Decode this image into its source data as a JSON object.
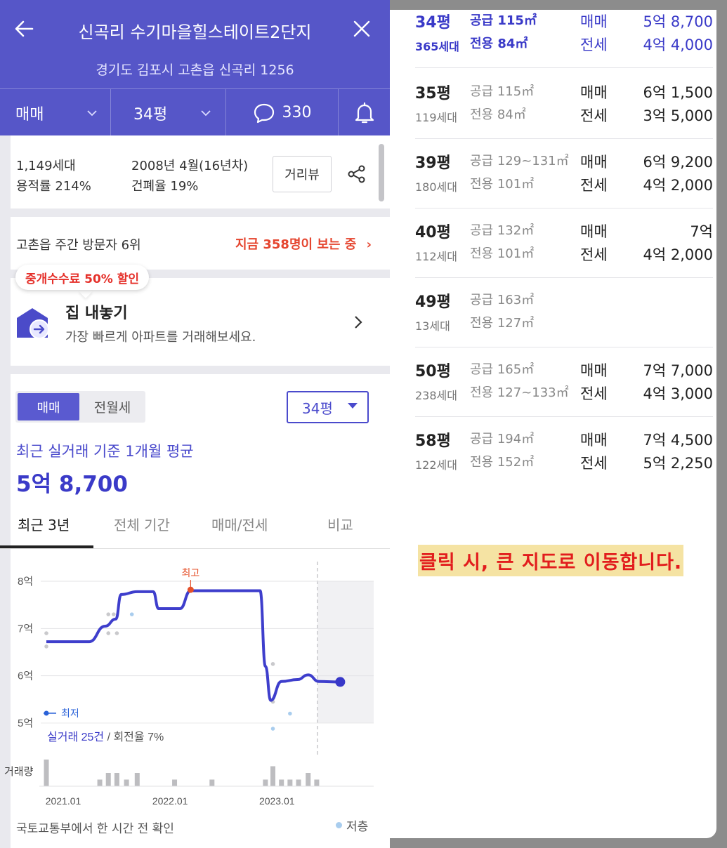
{
  "header": {
    "title": "신곡리 수기마을힐스테이트2단지",
    "address": "경기도 김포시 고촌읍 신곡리 1256",
    "trade_type": "매매",
    "size": "34평",
    "comment_count": "330"
  },
  "complex_info": {
    "households": "1,149세대",
    "floor_area_ratio": "용적률 214%",
    "built": "2008년 4월(16년차)",
    "building_coverage": "건폐율 19%",
    "street_view_label": "거리뷰"
  },
  "visitors": {
    "rank": "고촌읍 주간 방문자 6위",
    "now_viewing": "지금 358명이 보는 중",
    "chevron": "›"
  },
  "sell_card": {
    "promo": "중개수수료 50% 할인",
    "title": "집 내놓기",
    "subtitle": "가장 빠르게 아파트를 거래해보세요."
  },
  "deal": {
    "seg_sell": "매매",
    "seg_rent": "전월세",
    "size_select": "34평",
    "avg_label": "최근 실거래 기준 1개월 평균",
    "avg_price": "5억 8,700"
  },
  "tabs": [
    "최근 3년",
    "전체 기간",
    "매매/전세",
    "비교"
  ],
  "chart_data": {
    "type": "line",
    "y_unit": "억",
    "ylim": [
      5,
      8
    ],
    "yticks": [
      "8억",
      "7억",
      "6억",
      "5억"
    ],
    "xticks": [
      "2021.01",
      "2022.01",
      "2023.01"
    ],
    "max_label": "최고",
    "min_label": "최저",
    "summary_count": "실거래 25건",
    "summary_rate": " / 회전율 7%",
    "volume_label": "거래량",
    "line_color": "#3e3ecc",
    "max_color": "#e5502a",
    "line": [
      {
        "x": 2021.0,
        "y": 6.72
      },
      {
        "x": 2021.4,
        "y": 6.72
      },
      {
        "x": 2021.55,
        "y": 7.05
      },
      {
        "x": 2021.65,
        "y": 7.2
      },
      {
        "x": 2021.7,
        "y": 7.72
      },
      {
        "x": 2021.85,
        "y": 7.78
      },
      {
        "x": 2022.0,
        "y": 7.78
      },
      {
        "x": 2022.05,
        "y": 7.42
      },
      {
        "x": 2022.25,
        "y": 7.42
      },
      {
        "x": 2022.35,
        "y": 7.8
      },
      {
        "x": 2023.0,
        "y": 7.8
      },
      {
        "x": 2023.05,
        "y": 6.2
      },
      {
        "x": 2023.1,
        "y": 5.48
      },
      {
        "x": 2023.2,
        "y": 5.88
      },
      {
        "x": 2023.35,
        "y": 5.92
      },
      {
        "x": 2023.45,
        "y": 6.02
      },
      {
        "x": 2023.55,
        "y": 5.88
      },
      {
        "x": 2023.75,
        "y": 5.87
      }
    ],
    "max_point": {
      "x": 2022.35,
      "y": 7.82
    },
    "current_point": {
      "x": 2023.75,
      "y": 5.87
    },
    "deal_points_grey": [
      {
        "x": 2021.0,
        "y": 6.9
      },
      {
        "x": 2021.0,
        "y": 6.62
      },
      {
        "x": 2021.58,
        "y": 7.3
      },
      {
        "x": 2021.63,
        "y": 7.3
      },
      {
        "x": 2021.58,
        "y": 6.9
      },
      {
        "x": 2021.66,
        "y": 6.9
      },
      {
        "x": 2023.12,
        "y": 6.25
      },
      {
        "x": 2023.12,
        "y": 5.45
      }
    ],
    "deal_points_low": [
      {
        "x": 2021.8,
        "y": 7.3
      },
      {
        "x": 2023.12,
        "y": 4.88
      },
      {
        "x": 2023.28,
        "y": 5.2
      }
    ],
    "volume": [
      {
        "x": 2021.0,
        "v": 4
      },
      {
        "x": 2021.5,
        "v": 1
      },
      {
        "x": 2021.58,
        "v": 2
      },
      {
        "x": 2021.66,
        "v": 2
      },
      {
        "x": 2021.75,
        "v": 1
      },
      {
        "x": 2021.85,
        "v": 2
      },
      {
        "x": 2022.2,
        "v": 1
      },
      {
        "x": 2022.55,
        "v": 1
      },
      {
        "x": 2023.05,
        "v": 1
      },
      {
        "x": 2023.12,
        "v": 3
      },
      {
        "x": 2023.2,
        "v": 1
      },
      {
        "x": 2023.28,
        "v": 1
      },
      {
        "x": 2023.36,
        "v": 1
      },
      {
        "x": 2023.45,
        "v": 2
      },
      {
        "x": 2023.53,
        "v": 1
      }
    ],
    "x_range": [
      2021.0,
      2024.05
    ]
  },
  "footer": {
    "source": "국토교통부에서 한 시간 전 확인",
    "legend_low": "저층"
  },
  "size_list": [
    {
      "pyeong": "34평",
      "units": "365세대",
      "supply": "공급 115㎡",
      "exclusive": "전용 84㎡",
      "sell_label": "매매",
      "sell": "5억 8,700",
      "rent_label": "전세",
      "rent": "4억 4,000"
    },
    {
      "pyeong": "35평",
      "units": "119세대",
      "supply": "공급 115㎡",
      "exclusive": "전용 84㎡",
      "sell_label": "매매",
      "sell": "6억 1,500",
      "rent_label": "전세",
      "rent": "3억 5,000"
    },
    {
      "pyeong": "39평",
      "units": "180세대",
      "supply": "공급 129~131㎡",
      "exclusive": "전용 101㎡",
      "sell_label": "매매",
      "sell": "6억 9,200",
      "rent_label": "전세",
      "rent": "4억 2,000"
    },
    {
      "pyeong": "40평",
      "units": "112세대",
      "supply": "공급 132㎡",
      "exclusive": "전용 101㎡",
      "sell_label": "매매",
      "sell": "7억",
      "rent_label": "전세",
      "rent": "4억 2,000"
    },
    {
      "pyeong": "49평",
      "units": "13세대",
      "supply": "공급 163㎡",
      "exclusive": "전용 127㎡",
      "sell_label": "",
      "sell": "",
      "rent_label": "",
      "rent": ""
    },
    {
      "pyeong": "50평",
      "units": "238세대",
      "supply": "공급 165㎡",
      "exclusive": "전용 127~133㎡",
      "sell_label": "매매",
      "sell": "7억 7,000",
      "rent_label": "전세",
      "rent": "4억 3,000"
    },
    {
      "pyeong": "58평",
      "units": "122세대",
      "supply": "공급 194㎡",
      "exclusive": "전용 152㎡",
      "sell_label": "매매",
      "sell": "7억 4,500",
      "rent_label": "전세",
      "rent": "5억 2,250"
    }
  ],
  "map_note": "클릭 시, 큰 지도로 이동합니다."
}
